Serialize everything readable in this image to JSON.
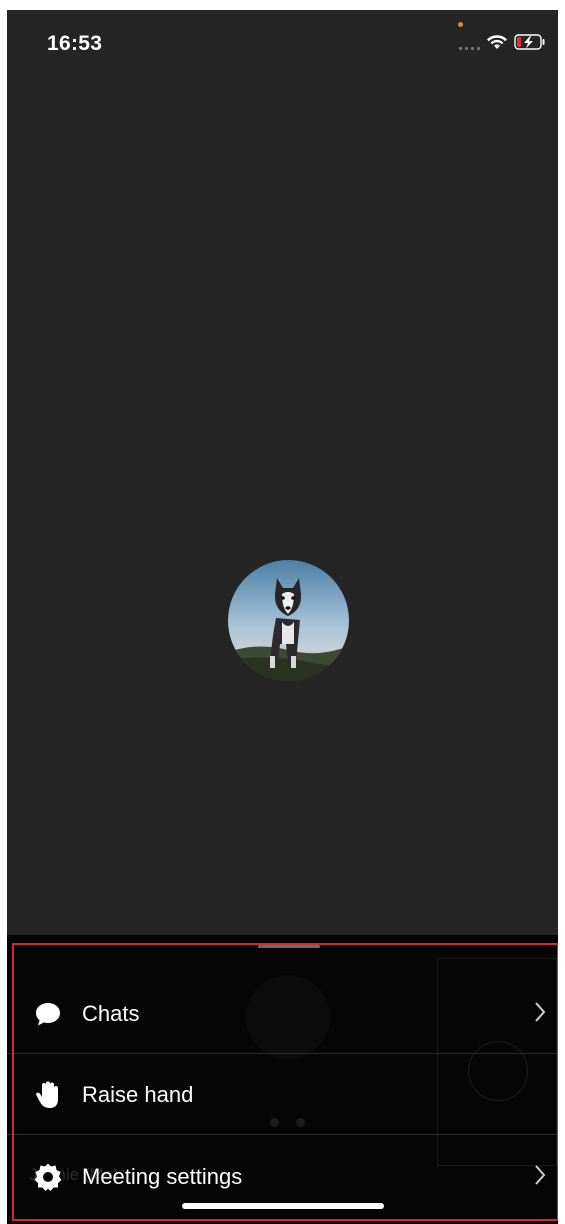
{
  "status_bar": {
    "time": "16:53",
    "icons": [
      "cellular-signal-icon",
      "wifi-icon",
      "battery-charging-icon"
    ],
    "colors": {
      "recording_dot": "#e08a1e",
      "battery_low": "#e4312f"
    }
  },
  "video": {
    "avatar": "husky-dog-avatar",
    "background": "#252525"
  },
  "background_behind_sheet": {
    "name_label": "Jennie (Me)"
  },
  "sheet": {
    "items": [
      {
        "label": "Chats",
        "icon": "chat-bubble-icon",
        "has_chevron": true
      },
      {
        "label": "Raise hand",
        "icon": "raise-hand-icon",
        "has_chevron": false
      },
      {
        "label": "Meeting settings",
        "icon": "gear-icon",
        "has_chevron": true
      }
    ],
    "highlight_color": "#d6292f"
  }
}
